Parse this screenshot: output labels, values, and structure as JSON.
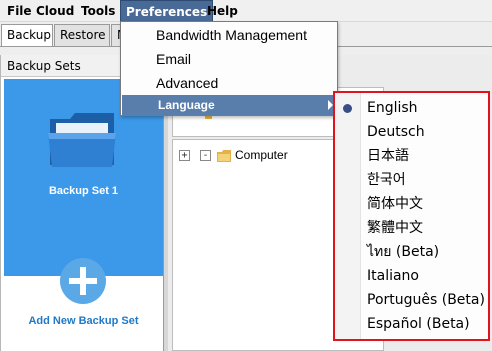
{
  "menubar": {
    "items": [
      {
        "label": "File"
      },
      {
        "label": "Cloud"
      },
      {
        "label": "Tools"
      },
      {
        "label": "Preferences"
      },
      {
        "label": "Help"
      }
    ]
  },
  "tabs": [
    {
      "label": "Backup"
    },
    {
      "label": "Restore"
    },
    {
      "label": "M"
    }
  ],
  "left_panel": {
    "header": "Backup Sets",
    "selected_set": "Backup Set 1",
    "add_new": "Add New Backup Set"
  },
  "tree": {
    "expand_symbol": "+",
    "collapse_symbol": "-",
    "root_label": "Computer"
  },
  "preferences_menu": {
    "items": [
      {
        "label": "Bandwidth Management"
      },
      {
        "label": "Email"
      },
      {
        "label": "Advanced"
      },
      {
        "label": "Language"
      }
    ]
  },
  "language_menu": {
    "selected": "English",
    "items": [
      {
        "label": "English"
      },
      {
        "label": "Deutsch"
      },
      {
        "label": "日本語"
      },
      {
        "label": "한국어"
      },
      {
        "label": "简体中文"
      },
      {
        "label": "繁體中文"
      },
      {
        "label": "ไทย (Beta)"
      },
      {
        "label": "Italiano"
      },
      {
        "label": "Português (Beta)"
      },
      {
        "label": "Español (Beta)"
      }
    ]
  },
  "colors": {
    "selection_blue": "#3c98e9",
    "menu_highlight": "#5a7eac",
    "submenu_border": "#e0141a",
    "add_link": "#1f78c8"
  }
}
